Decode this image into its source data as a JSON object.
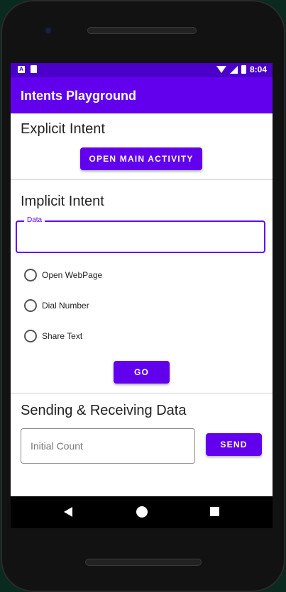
{
  "status_bar": {
    "left_icons": [
      "a-notification-icon",
      "sd-card-icon"
    ],
    "notification_letter": "A",
    "right_icons": [
      "wifi-icon",
      "signal-icon",
      "battery-icon"
    ],
    "time": "8:04"
  },
  "app_bar": {
    "title": "Intents Playground"
  },
  "explicit": {
    "title": "Explicit Intent",
    "button_label": "OPEN MAIN ACTIVITY"
  },
  "implicit": {
    "title": "Implicit Intent",
    "data_field": {
      "label": "Data",
      "value": ""
    },
    "options": [
      {
        "label": "Open WebPage",
        "selected": false
      },
      {
        "label": "Dial Number",
        "selected": false
      },
      {
        "label": "Share Text",
        "selected": false
      }
    ],
    "go_label": "GO"
  },
  "sending": {
    "title": "Sending & Receiving Data",
    "count_placeholder": "Initial Count",
    "send_label": "SEND"
  },
  "colors": {
    "primary": "#6200ee",
    "status_bar": "#4a00c8"
  },
  "nav_bar": {
    "icons": [
      "back-icon",
      "home-icon",
      "recents-icon"
    ]
  }
}
